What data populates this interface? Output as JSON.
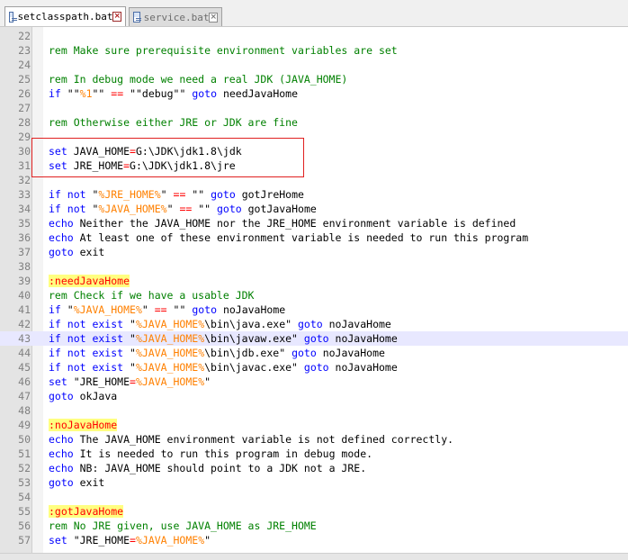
{
  "tabs": [
    {
      "label": "setclasspath.bat",
      "active": true
    },
    {
      "label": "service.bat",
      "active": false
    }
  ],
  "lines": [
    {
      "n": "22",
      "segs": []
    },
    {
      "n": "23",
      "segs": [
        [
          "cm",
          "rem Make sure prerequisite environment variables are set"
        ]
      ]
    },
    {
      "n": "24",
      "segs": []
    },
    {
      "n": "25",
      "segs": [
        [
          "cm",
          "rem In debug mode we need a real JDK (JAVA_HOME)"
        ]
      ]
    },
    {
      "n": "26",
      "segs": [
        [
          "kw",
          "if "
        ],
        [
          "tx",
          "\"\""
        ],
        [
          "var",
          "%1"
        ],
        [
          "tx",
          "\"\" "
        ],
        [
          "op",
          "=="
        ],
        [
          "tx",
          " \"\"debug\"\" "
        ],
        [
          "kw",
          "goto"
        ],
        [
          "tx",
          " needJavaHome"
        ]
      ]
    },
    {
      "n": "27",
      "segs": []
    },
    {
      "n": "28",
      "segs": [
        [
          "cm",
          "rem Otherwise either JRE or JDK are fine"
        ]
      ]
    },
    {
      "n": "29",
      "segs": []
    },
    {
      "n": "30",
      "segs": [
        [
          "kw",
          "set"
        ],
        [
          "tx",
          " JAVA_HOME"
        ],
        [
          "op",
          "="
        ],
        [
          "tx",
          "G:\\JDK\\jdk1.8\\jdk"
        ]
      ]
    },
    {
      "n": "31",
      "segs": [
        [
          "kw",
          "set"
        ],
        [
          "tx",
          " JRE_HOME"
        ],
        [
          "op",
          "="
        ],
        [
          "tx",
          "G:\\JDK\\jdk1.8\\jre"
        ]
      ]
    },
    {
      "n": "32",
      "segs": []
    },
    {
      "n": "33",
      "segs": [
        [
          "kw",
          "if not "
        ],
        [
          "tx",
          "\""
        ],
        [
          "var",
          "%JRE_HOME%"
        ],
        [
          "tx",
          "\" "
        ],
        [
          "op",
          "=="
        ],
        [
          "tx",
          " \"\" "
        ],
        [
          "kw",
          "goto"
        ],
        [
          "tx",
          " gotJreHome"
        ]
      ]
    },
    {
      "n": "34",
      "segs": [
        [
          "kw",
          "if not "
        ],
        [
          "tx",
          "\""
        ],
        [
          "var",
          "%JAVA_HOME%"
        ],
        [
          "tx",
          "\" "
        ],
        [
          "op",
          "=="
        ],
        [
          "tx",
          " \"\" "
        ],
        [
          "kw",
          "goto"
        ],
        [
          "tx",
          " gotJavaHome"
        ]
      ]
    },
    {
      "n": "35",
      "segs": [
        [
          "kw",
          "echo"
        ],
        [
          "tx",
          " Neither the JAVA_HOME nor the JRE_HOME environment variable is defined"
        ]
      ]
    },
    {
      "n": "36",
      "segs": [
        [
          "kw",
          "echo"
        ],
        [
          "tx",
          " At least one of these environment variable is needed to run this program"
        ]
      ]
    },
    {
      "n": "37",
      "segs": [
        [
          "kw",
          "goto"
        ],
        [
          "tx",
          " exit"
        ]
      ]
    },
    {
      "n": "38",
      "segs": []
    },
    {
      "n": "39",
      "segs": [
        [
          "lbl",
          ":needJavaHome"
        ]
      ]
    },
    {
      "n": "40",
      "segs": [
        [
          "cm",
          "rem Check if we have a usable JDK"
        ]
      ]
    },
    {
      "n": "41",
      "segs": [
        [
          "kw",
          "if "
        ],
        [
          "tx",
          "\""
        ],
        [
          "var",
          "%JAVA_HOME%"
        ],
        [
          "tx",
          "\" "
        ],
        [
          "op",
          "=="
        ],
        [
          "tx",
          " \"\" "
        ],
        [
          "kw",
          "goto"
        ],
        [
          "tx",
          " noJavaHome"
        ]
      ]
    },
    {
      "n": "42",
      "segs": [
        [
          "kw",
          "if not exist "
        ],
        [
          "tx",
          "\""
        ],
        [
          "var",
          "%JAVA_HOME%"
        ],
        [
          "tx",
          "\\bin\\java.exe\" "
        ],
        [
          "kw",
          "goto"
        ],
        [
          "tx",
          " noJavaHome"
        ]
      ]
    },
    {
      "n": "43",
      "segs": [
        [
          "kw",
          "if not exist "
        ],
        [
          "tx",
          "\""
        ],
        [
          "var",
          "%JAVA_HOME%"
        ],
        [
          "tx",
          "\\bin\\javaw.exe\" "
        ],
        [
          "kw",
          "goto"
        ],
        [
          "tx",
          " noJavaHome"
        ]
      ]
    },
    {
      "n": "44",
      "segs": [
        [
          "kw",
          "if not exist "
        ],
        [
          "tx",
          "\""
        ],
        [
          "var",
          "%JAVA_HOME%"
        ],
        [
          "tx",
          "\\bin\\jdb.exe\" "
        ],
        [
          "kw",
          "goto"
        ],
        [
          "tx",
          " noJavaHome"
        ]
      ]
    },
    {
      "n": "45",
      "segs": [
        [
          "kw",
          "if not exist "
        ],
        [
          "tx",
          "\""
        ],
        [
          "var",
          "%JAVA_HOME%"
        ],
        [
          "tx",
          "\\bin\\javac.exe\" "
        ],
        [
          "kw",
          "goto"
        ],
        [
          "tx",
          " noJavaHome"
        ]
      ]
    },
    {
      "n": "46",
      "segs": [
        [
          "kw",
          "set"
        ],
        [
          "tx",
          " \"JRE_HOME"
        ],
        [
          "op",
          "="
        ],
        [
          "var",
          "%JAVA_HOME%"
        ],
        [
          "tx",
          "\""
        ]
      ]
    },
    {
      "n": "47",
      "segs": [
        [
          "kw",
          "goto"
        ],
        [
          "tx",
          " okJava"
        ]
      ]
    },
    {
      "n": "48",
      "segs": []
    },
    {
      "n": "49",
      "segs": [
        [
          "lbl",
          ":noJavaHome"
        ]
      ]
    },
    {
      "n": "50",
      "segs": [
        [
          "kw",
          "echo"
        ],
        [
          "tx",
          " The JAVA_HOME environment variable is not defined correctly."
        ]
      ]
    },
    {
      "n": "51",
      "segs": [
        [
          "kw",
          "echo"
        ],
        [
          "tx",
          " It is needed to run this program in debug mode."
        ]
      ]
    },
    {
      "n": "52",
      "segs": [
        [
          "kw",
          "echo"
        ],
        [
          "tx",
          " NB: JAVA_HOME should point to a JDK not a JRE."
        ]
      ]
    },
    {
      "n": "53",
      "segs": [
        [
          "kw",
          "goto"
        ],
        [
          "tx",
          " exit"
        ]
      ]
    },
    {
      "n": "54",
      "segs": []
    },
    {
      "n": "55",
      "segs": [
        [
          "lbl",
          ":gotJavaHome"
        ]
      ]
    },
    {
      "n": "56",
      "segs": [
        [
          "cm",
          "rem No JRE given, use JAVA_HOME as JRE_HOME"
        ]
      ]
    },
    {
      "n": "57",
      "segs": [
        [
          "kw",
          "set"
        ],
        [
          "tx",
          " \"JRE_HOME"
        ],
        [
          "op",
          "="
        ],
        [
          "var",
          "%JAVA_HOME%"
        ],
        [
          "tx",
          "\""
        ]
      ]
    }
  ],
  "current_line": "43",
  "colors": {
    "keyword": "#0000ff",
    "comment": "#008000",
    "variable": "#ff8000",
    "operator": "#ff0000",
    "label_bg": "#ffff80",
    "annotation_box": "#e02020"
  }
}
